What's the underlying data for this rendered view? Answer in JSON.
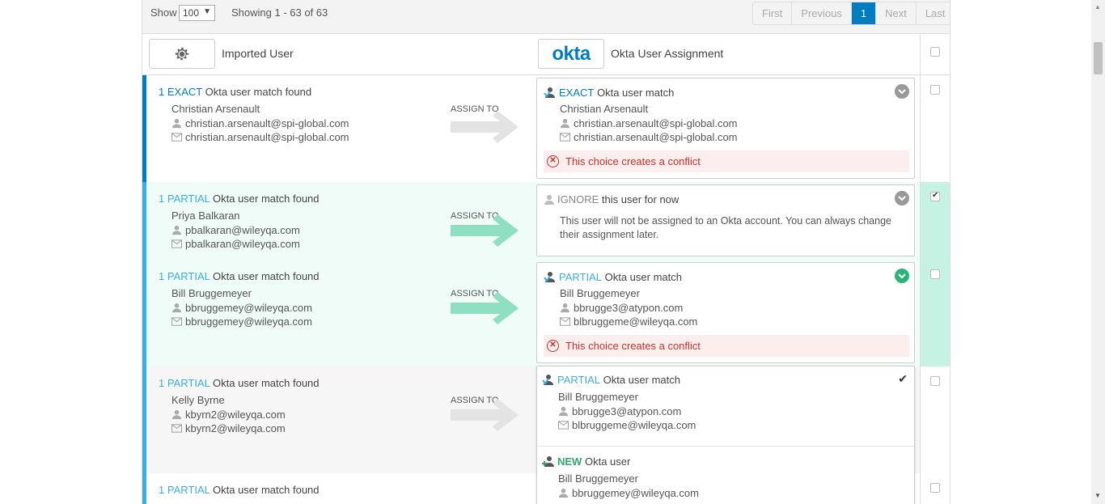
{
  "toolbar": {
    "show_label": "Show",
    "page_size": "100",
    "showing": "Showing 1 - 63 of 63",
    "pager": [
      "First",
      "Previous",
      "1",
      "Next",
      "Last"
    ]
  },
  "header": {
    "imported_label": "Imported User",
    "okta_logo": "okta",
    "assignment_label": "Okta User Assignment"
  },
  "assign_label": "ASSIGN TO",
  "rows": [
    {
      "count": "1",
      "kind": "EXACT",
      "found_text": "Okta user match found",
      "name": "Christian Arsenault",
      "login": "christian.arsenault@spi-global.com",
      "email": "christian.arsenault@spi-global.com",
      "card": {
        "kind": "EXACT",
        "title_rest": "Okta user match",
        "name": "Christian Arsenault",
        "login": "christian.arsenault@spi-global.com",
        "email": "christian.arsenault@spi-global.com",
        "conflict": "This choice creates a conflict"
      }
    },
    {
      "count": "1",
      "kind": "PARTIAL",
      "found_text": "Okta user match found",
      "name": "Priya Balkaran",
      "login": "pbalkaran@wileyqa.com",
      "email": "pbalkaran@wileyqa.com",
      "card": {
        "kind": "IGNORE",
        "title_rest": "this user for now",
        "message": "This user will not be assigned to an Okta account. You can always change their assignment later."
      }
    },
    {
      "count": "1",
      "kind": "PARTIAL",
      "found_text": "Okta user match found",
      "name": "Bill Bruggemeyer",
      "login": "bbruggemey@wileyqa.com",
      "email": "bbruggemey@wileyqa.com",
      "card": {
        "kind": "PARTIAL",
        "title_rest": "Okta user match",
        "name": "Bill Bruggemeyer",
        "login": "bbrugge3@atypon.com",
        "email": "blbruggeme@wileyqa.com",
        "conflict": "This choice creates a conflict"
      }
    },
    {
      "count": "1",
      "kind": "PARTIAL",
      "found_text": "Okta user match found",
      "name": "Kelly Byrne",
      "login": "kbyrn2@wileyqa.com",
      "email": "kbyrn2@wileyqa.com",
      "options": [
        {
          "kind": "PARTIAL",
          "title_rest": "Okta user match",
          "name": "Bill Bruggemeyer",
          "login": "bbrugge3@atypon.com",
          "email": "blbruggeme@wileyqa.com"
        },
        {
          "kind": "NEW",
          "title_rest": "Okta user",
          "name": "Bill Bruggemeyer",
          "login": "bbruggemey@wileyqa.com"
        }
      ]
    },
    {
      "count": "1",
      "kind": "PARTIAL",
      "found_text": "Okta user match found"
    }
  ],
  "colors": {
    "exact": "#007cc0",
    "partial": "#3aade2",
    "selected_bg": "#f0fcf8",
    "selected_check_bg": "#c5f2e2",
    "arrow_active": "#8fe0c3",
    "arrow_inactive": "#e3e3e3",
    "conflict": "#c9302c"
  }
}
